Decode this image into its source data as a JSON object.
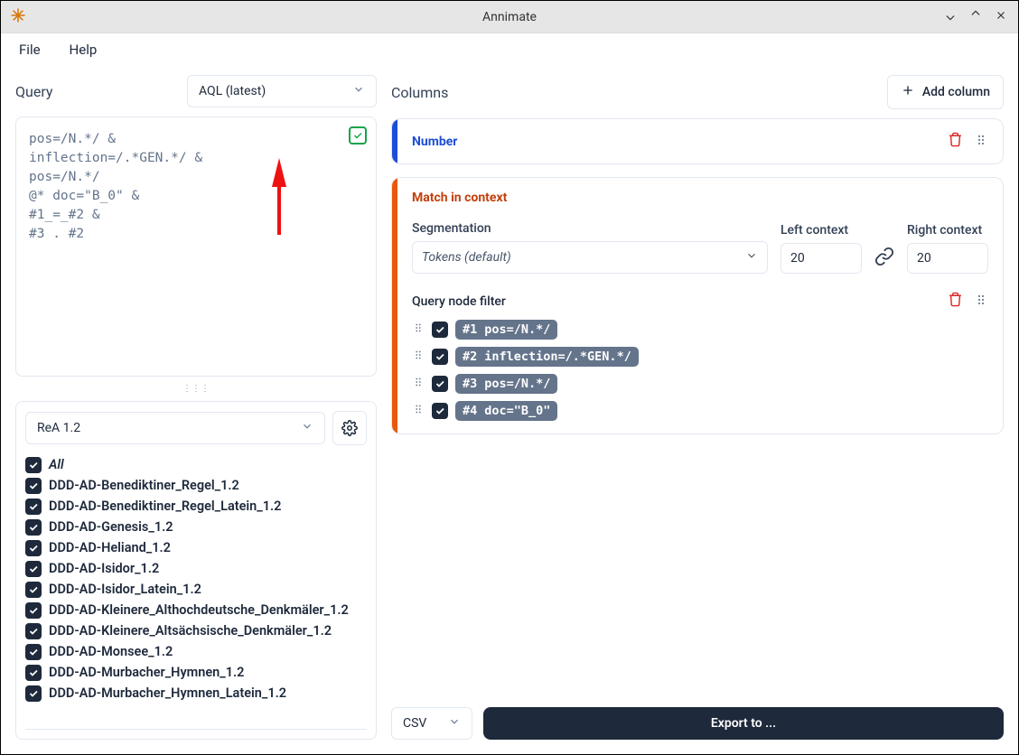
{
  "window": {
    "title": "Annimate"
  },
  "menu": {
    "file": "File",
    "help": "Help"
  },
  "query": {
    "label": "Query",
    "language": "AQL (latest)",
    "text": "pos=/N.*/ &\ninflection=/.*GEN.*/ &\npos=/N.*/\n@* doc=\"B_0\" &\n#1_=_#2 &\n#3 . #2"
  },
  "corpus": {
    "set": "ReA 1.2",
    "all_label": "All",
    "items": [
      "DDD-AD-Benediktiner_Regel_1.2",
      "DDD-AD-Benediktiner_Regel_Latein_1.2",
      "DDD-AD-Genesis_1.2",
      "DDD-AD-Heliand_1.2",
      "DDD-AD-Isidor_1.2",
      "DDD-AD-Isidor_Latein_1.2",
      "DDD-AD-Kleinere_Althochdeutsche_Denkmäler_1.2",
      "DDD-AD-Kleinere_Altsächsische_Denkmäler_1.2",
      "DDD-AD-Monsee_1.2",
      "DDD-AD-Murbacher_Hymnen_1.2",
      "DDD-AD-Murbacher_Hymnen_Latein_1.2"
    ]
  },
  "columns": {
    "label": "Columns",
    "add_label": "Add column",
    "number": {
      "title": "Number"
    },
    "match": {
      "title": "Match in context",
      "segmentation_label": "Segmentation",
      "segmentation_value": "Tokens (default)",
      "left_label": "Left context",
      "left_value": "20",
      "right_label": "Right context",
      "right_value": "20",
      "filter_label": "Query node filter",
      "filters": [
        {
          "idx": "#1",
          "expr": "pos=/N.*/"
        },
        {
          "idx": "#2",
          "expr": "inflection=/.*GEN.*/"
        },
        {
          "idx": "#3",
          "expr": "pos=/N.*/"
        },
        {
          "idx": "#4",
          "expr": "doc=\"B_0\""
        }
      ]
    }
  },
  "export": {
    "format": "CSV",
    "button": "Export to ..."
  }
}
